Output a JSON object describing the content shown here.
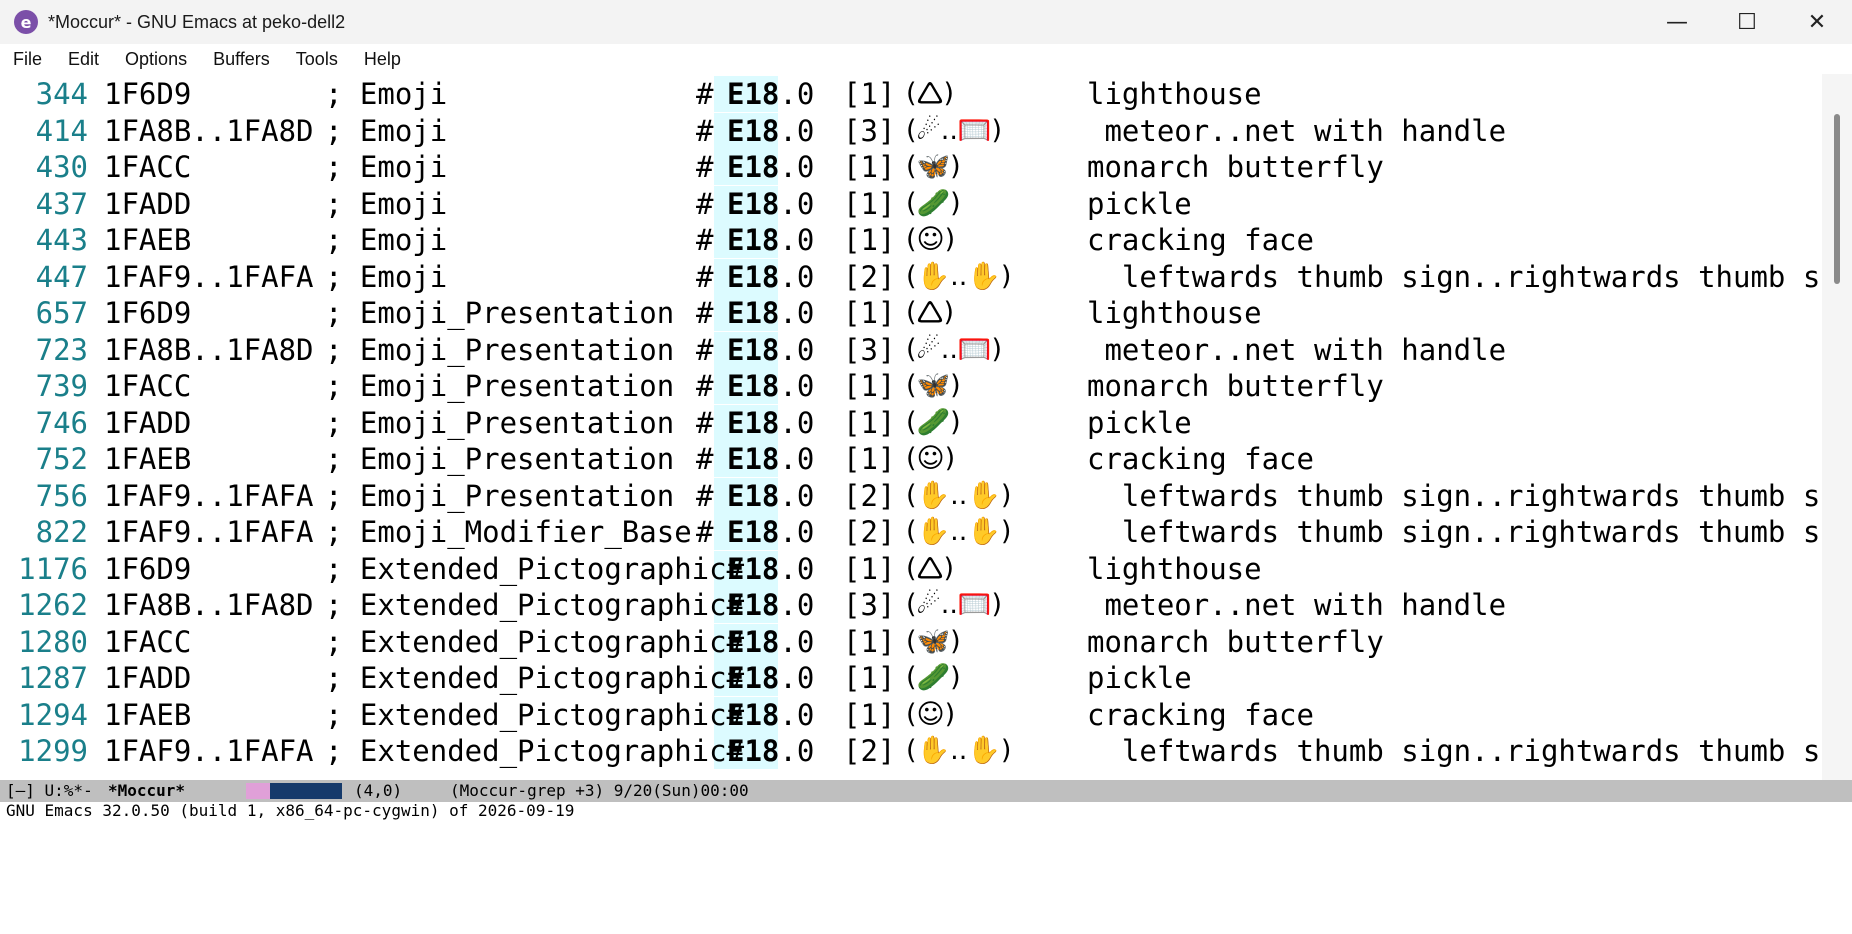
{
  "window": {
    "title": "*Moccur* - GNU Emacs at peko-dell2",
    "app_icon": "emacs-icon",
    "controls": [
      "—",
      "☐",
      "✕"
    ]
  },
  "menu": [
    "File",
    "Edit",
    "Options",
    "Buffers",
    "Tools",
    "Help"
  ],
  "lines": [
    {
      "lno": "344",
      "cp": "1F6D9",
      "prop": "; Emoji",
      "hash": "#",
      "ver_bold": "E18",
      "ver_rest": ".0",
      "count": "[1]",
      "emoji": "(🛆)",
      "name": "lighthouse"
    },
    {
      "lno": "414",
      "cp": "1FA8B..1FA8D",
      "prop": "; Emoji",
      "hash": "#",
      "ver_bold": "E18",
      "ver_rest": ".0",
      "count": "[3]",
      "emoji": "(☄..🥅)",
      "name": " meteor..net with handle"
    },
    {
      "lno": "430",
      "cp": "1FACC",
      "prop": "; Emoji",
      "hash": "#",
      "ver_bold": "E18",
      "ver_rest": ".0",
      "count": "[1]",
      "emoji": "(🦋)",
      "name": "monarch butterfly"
    },
    {
      "lno": "437",
      "cp": "1FADD",
      "prop": "; Emoji",
      "hash": "#",
      "ver_bold": "E18",
      "ver_rest": ".0",
      "count": "[1]",
      "emoji": "(🥒)",
      "name": "pickle"
    },
    {
      "lno": "443",
      "cp": "1FAEB",
      "prop": "; Emoji",
      "hash": "#",
      "ver_bold": "E18",
      "ver_rest": ".0",
      "count": "[1]",
      "emoji": "(☺)",
      "name": "cracking face"
    },
    {
      "lno": "447",
      "cp": "1FAF9..1FAFA",
      "prop": "; Emoji",
      "hash": "#",
      "ver_bold": "E18",
      "ver_rest": ".0",
      "count": "[2]",
      "emoji": "(✋..✋)",
      "name": "  leftwards thumb sign..rightwards thumb sign"
    },
    {
      "lno": "657",
      "cp": "1F6D9",
      "prop": "; Emoji_Presentation",
      "hash": "#",
      "ver_bold": "E18",
      "ver_rest": ".0",
      "count": "[1]",
      "emoji": "(🛆)",
      "name": "lighthouse"
    },
    {
      "lno": "723",
      "cp": "1FA8B..1FA8D",
      "prop": "; Emoji_Presentation",
      "hash": "#",
      "ver_bold": "E18",
      "ver_rest": ".0",
      "count": "[3]",
      "emoji": "(☄..🥅)",
      "name": " meteor..net with handle"
    },
    {
      "lno": "739",
      "cp": "1FACC",
      "prop": "; Emoji_Presentation",
      "hash": "#",
      "ver_bold": "E18",
      "ver_rest": ".0",
      "count": "[1]",
      "emoji": "(🦋)",
      "name": "monarch butterfly"
    },
    {
      "lno": "746",
      "cp": "1FADD",
      "prop": "; Emoji_Presentation",
      "hash": "#",
      "ver_bold": "E18",
      "ver_rest": ".0",
      "count": "[1]",
      "emoji": "(🥒)",
      "name": "pickle"
    },
    {
      "lno": "752",
      "cp": "1FAEB",
      "prop": "; Emoji_Presentation",
      "hash": "#",
      "ver_bold": "E18",
      "ver_rest": ".0",
      "count": "[1]",
      "emoji": "(☺)",
      "name": "cracking face"
    },
    {
      "lno": "756",
      "cp": "1FAF9..1FAFA",
      "prop": "; Emoji_Presentation",
      "hash": "#",
      "ver_bold": "E18",
      "ver_rest": ".0",
      "count": "[2]",
      "emoji": "(✋..✋)",
      "name": "  leftwards thumb sign..rightwards thumb sign"
    },
    {
      "lno": "822",
      "cp": "1FAF9..1FAFA",
      "prop": "; Emoji_Modifier_Base",
      "hash": "#",
      "ver_bold": "E18",
      "ver_rest": ".0",
      "count": "[2]",
      "emoji": "(✋..✋)",
      "name": "  leftwards thumb sign..rightwards thumb sign"
    },
    {
      "lno": "1176",
      "cp": "1F6D9",
      "prop": "; Extended_Pictographic#",
      "hash": "",
      "ver_bold": "E18",
      "ver_rest": ".0",
      "count": "[1]",
      "emoji": "(🛆)",
      "name": "lighthouse"
    },
    {
      "lno": "1262",
      "cp": "1FA8B..1FA8D",
      "prop": "; Extended_Pictographic#",
      "hash": "",
      "ver_bold": "E18",
      "ver_rest": ".0",
      "count": "[3]",
      "emoji": "(☄..🥅)",
      "name": " meteor..net with handle"
    },
    {
      "lno": "1280",
      "cp": "1FACC",
      "prop": "; Extended_Pictographic#",
      "hash": "",
      "ver_bold": "E18",
      "ver_rest": ".0",
      "count": "[1]",
      "emoji": "(🦋)",
      "name": "monarch butterfly"
    },
    {
      "lno": "1287",
      "cp": "1FADD",
      "prop": "; Extended_Pictographic#",
      "hash": "",
      "ver_bold": "E18",
      "ver_rest": ".0",
      "count": "[1]",
      "emoji": "(🥒)",
      "name": "pickle"
    },
    {
      "lno": "1294",
      "cp": "1FAEB",
      "prop": "; Extended_Pictographic#",
      "hash": "",
      "ver_bold": "E18",
      "ver_rest": ".0",
      "count": "[1]",
      "emoji": "(☺)",
      "name": "cracking face"
    },
    {
      "lno": "1299",
      "cp": "1FAF9..1FAFA",
      "prop": "; Extended_Pictographic#",
      "hash": "",
      "ver_bold": "E18",
      "ver_rest": ".0",
      "count": "[2]",
      "emoji": "(✋..✋)",
      "name": "  leftwards thumb sign..rightwards thumb sign"
    }
  ],
  "modeline": {
    "status": "[—] U:%*-",
    "buffer": "*Moccur*",
    "position": "(4,0)",
    "modes": "(Moccur-grep +3) 9/20(Sun)00:00"
  },
  "minibuffer": "GNU Emacs 32.0.50 (build 1, x86_64-pc-cygwin) of 2026-09-19",
  "colors": {
    "line_number": "#1a7f8a",
    "highlight": "#dcfbff",
    "modeline_bg": "#bfbfbf"
  }
}
